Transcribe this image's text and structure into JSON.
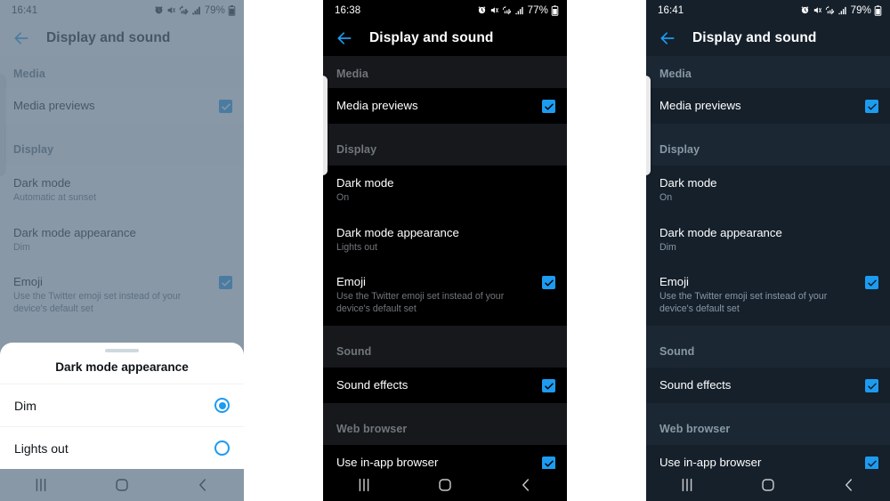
{
  "accent_blue": "#1d9bf0",
  "panels": [
    {
      "id": "panel-dim-with-dialog",
      "theme": "light-dimmed",
      "status": {
        "time": "16:41",
        "battery": "79%"
      },
      "appbar": {
        "back_label": "Back",
        "title": "Display and sound"
      },
      "sections": [
        {
          "header": "Media",
          "rows": [
            {
              "title": "Media previews",
              "subtitle": "",
              "control": "checkbox",
              "checked": true
            }
          ]
        },
        {
          "header": "Display",
          "rows": [
            {
              "title": "Dark mode",
              "subtitle": "Automatic at sunset",
              "control": "none",
              "checked": false
            },
            {
              "title": "Dark mode appearance",
              "subtitle": "Dim",
              "control": "none",
              "checked": false
            },
            {
              "title": "Emoji",
              "subtitle": "Use the Twitter emoji set instead of your device's default set",
              "control": "checkbox",
              "checked": true
            }
          ]
        }
      ],
      "dialog": {
        "title": "Dark mode appearance",
        "options": [
          {
            "label": "Dim",
            "selected": true
          },
          {
            "label": "Lights out",
            "selected": false
          }
        ]
      }
    },
    {
      "id": "panel-lights-out",
      "theme": "lights-out",
      "status": {
        "time": "16:38",
        "battery": "77%"
      },
      "appbar": {
        "back_label": "Back",
        "title": "Display and sound"
      },
      "sections": [
        {
          "header": "Media",
          "rows": [
            {
              "title": "Media previews",
              "subtitle": "",
              "control": "checkbox",
              "checked": true
            }
          ]
        },
        {
          "header": "Display",
          "rows": [
            {
              "title": "Dark mode",
              "subtitle": "On",
              "control": "none",
              "checked": false
            },
            {
              "title": "Dark mode appearance",
              "subtitle": "Lights out",
              "control": "none",
              "checked": false
            },
            {
              "title": "Emoji",
              "subtitle": "Use the Twitter emoji set instead of your device's default set",
              "control": "checkbox",
              "checked": true
            }
          ]
        },
        {
          "header": "Sound",
          "rows": [
            {
              "title": "Sound effects",
              "subtitle": "",
              "control": "checkbox",
              "checked": true
            }
          ]
        },
        {
          "header": "Web browser",
          "rows": [
            {
              "title": "Use in-app browser",
              "subtitle": "",
              "control": "checkbox",
              "checked": true
            }
          ]
        }
      ],
      "dialog": null
    },
    {
      "id": "panel-dim",
      "theme": "dim",
      "status": {
        "time": "16:41",
        "battery": "79%"
      },
      "appbar": {
        "back_label": "Back",
        "title": "Display and sound"
      },
      "sections": [
        {
          "header": "Media",
          "rows": [
            {
              "title": "Media previews",
              "subtitle": "",
              "control": "checkbox",
              "checked": true
            }
          ]
        },
        {
          "header": "Display",
          "rows": [
            {
              "title": "Dark mode",
              "subtitle": "On",
              "control": "none",
              "checked": false
            },
            {
              "title": "Dark mode appearance",
              "subtitle": "Dim",
              "control": "none",
              "checked": false
            },
            {
              "title": "Emoji",
              "subtitle": "Use the Twitter emoji set instead of your device's default set",
              "control": "checkbox",
              "checked": true
            }
          ]
        },
        {
          "header": "Sound",
          "rows": [
            {
              "title": "Sound effects",
              "subtitle": "",
              "control": "checkbox",
              "checked": true
            }
          ]
        },
        {
          "header": "Web browser",
          "rows": [
            {
              "title": "Use in-app browser",
              "subtitle": "",
              "control": "checkbox",
              "checked": true
            }
          ]
        }
      ],
      "dialog": null
    }
  ],
  "status_icon_names": [
    "alarm-icon",
    "mute-icon",
    "sync-icon",
    "signal-bars-icon",
    "battery-icon"
  ],
  "navbar": {
    "recents_label": "Recents",
    "home_label": "Home",
    "back_label": "Back"
  }
}
